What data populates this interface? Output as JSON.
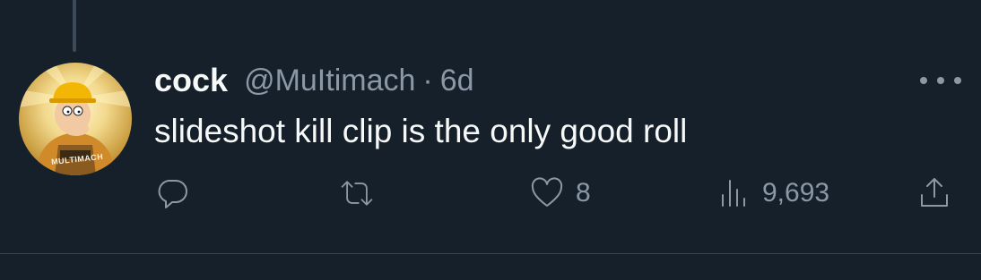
{
  "tweet": {
    "display_name": "cock",
    "handle": "@MuItimach",
    "separator": "·",
    "time": "6d",
    "text": "slideshot kill clip is the only good roll",
    "avatar": {
      "icon": "cartoon-character-avatar",
      "text": "MULTIMACH"
    },
    "actions": {
      "reply": {
        "icon": "reply-icon",
        "count": ""
      },
      "retweet": {
        "icon": "retweet-icon",
        "count": ""
      },
      "like": {
        "icon": "heart-icon",
        "count": "8"
      },
      "views": {
        "icon": "views-chart-icon",
        "count": "9,693"
      },
      "share": {
        "icon": "share-icon"
      }
    },
    "more_icon": "more-options-icon"
  },
  "colors": {
    "background": "#15202b",
    "primary_text": "#f7f9f9",
    "secondary_text": "#8b98a5",
    "divider": "#38444d",
    "thread_line": "#3d4b59"
  }
}
